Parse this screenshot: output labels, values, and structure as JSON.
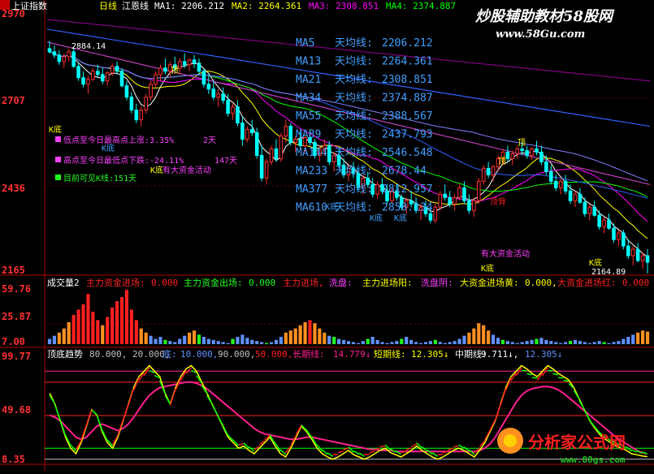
{
  "colors": {
    "bg": "#000000",
    "axis": "#b00000",
    "grid": "#700000",
    "up": "#ff3030",
    "down": "#00ffff",
    "ma": [
      "#ffffff",
      "#ffff00",
      "#ff00ff",
      "#00ff00",
      "#3060ff",
      "#8080ff",
      "#c040c0",
      "#a0a0a0",
      "#800080",
      "#d0d0d0"
    ],
    "vol_red": "#ff2020",
    "vol_orange": "#ff9020",
    "vol_blue": "#6090ff",
    "vol_green": "#20ff20",
    "osc_yellow": "#ffff00",
    "osc_green": "#00ff00",
    "osc_red": "#ff2020",
    "osc_pink": "#ff2090",
    "osc_gray": "#c0c0c0",
    "label_cyan": "#40a0ff",
    "label_yellow": "#ffff00",
    "label_magenta": "#ff40ff",
    "wm_red": "#ff2020",
    "wm_green": "#20c020",
    "wm_orange": "#ff8000",
    "wm_gold": "#ffd000"
  },
  "header": {
    "symbol": "上证指数",
    "period": "日线",
    "indicator": "江恩线",
    "ma1": "MA1: 2206.212",
    "ma2": "MA2: 2264.361",
    "ma3": "MA3: 2308.851",
    "ma4": "MA4: 2374.887"
  },
  "watermark_top": "炒股辅助教材58股网",
  "watermark_top_url": "www.58Gu.com",
  "watermark_bottom": "分析家公式网",
  "watermark_bottom_url": "www.88gs.com",
  "ma_legend": [
    {
      "name": "MA5",
      "label": "天均线:",
      "value": "2206.212"
    },
    {
      "name": "MA13",
      "label": "天均线:",
      "value": "2264.361"
    },
    {
      "name": "MA21",
      "label": "天均线:",
      "value": "2308.851"
    },
    {
      "name": "MA34",
      "label": "天均线:",
      "value": "2374.887"
    },
    {
      "name": "MA55",
      "label": "天均线:",
      "value": "2388.567"
    },
    {
      "name": "MA89",
      "label": "天均线:",
      "value": "2437.793"
    },
    {
      "name": "MA144",
      "label": "天均线:",
      "value": "2546.548"
    },
    {
      "name": "MA233",
      "label": "天均线:",
      "value": "2678.44"
    },
    {
      "name": "MA377",
      "label": "天均线:",
      "value": "2812.957"
    },
    {
      "name": "MA610",
      "label": "天均线:",
      "value": "2850.134"
    }
  ],
  "stats": [
    {
      "text": "低点至今日最高点上涨:3.35%",
      "extra": "2天",
      "color": "#ff40ff"
    },
    {
      "text": "高点至今日最低点下跌:-24.11%",
      "extra": "147天",
      "color": "#ff40ff"
    },
    {
      "text": "目前可见K线:151天",
      "extra": "",
      "color": "#20ff20"
    }
  ],
  "annotations": {
    "k_bottom": "K底",
    "top": "顶",
    "big_fund": "有大资金活动",
    "price_high": "2884.14",
    "price_low": "2164.89",
    "weak": "顶背"
  },
  "price_axis": {
    "ticks": [
      "2970",
      "2707",
      "2436",
      "2165"
    ]
  },
  "volume_panel": {
    "title": "成交量2",
    "items": [
      {
        "label": "主力资金进场:",
        "value": "0.000",
        "color": "#ff2020"
      },
      {
        "label": "主力资金出场:",
        "value": "0.000",
        "color": "#20ff20"
      },
      {
        "label": "主力进场,",
        "value": "",
        "color": "#ff2020"
      },
      {
        "label": "洗盘:",
        "value": "",
        "color": "#ff40ff"
      },
      {
        "label": "主力进场阳:",
        "value": "",
        "color": "#ffff00"
      },
      {
        "label": "洗盘阴:",
        "value": "",
        "color": "#ff40ff"
      },
      {
        "label": "大资金进场黄:",
        "value": "0.000,",
        "color": "#ffff00"
      },
      {
        "label": "大资金进场红:",
        "value": "0.000",
        "color": "#ff2020"
      }
    ],
    "ticks": [
      "59.76",
      "25.87",
      "7.00"
    ]
  },
  "osc_panel": {
    "title": "顶底趋势",
    "params": "80.000, 20.000,",
    "items": [
      {
        "label": "底:",
        "value": "10.000,",
        "color": "#6090ff"
      },
      {
        "label": "",
        "value": "90.000,",
        "color": "#c0c0c0"
      },
      {
        "label": "",
        "value": "50.000,",
        "color": "#ff2020"
      },
      {
        "label": "长期线:",
        "value": "14.779↓",
        "color": "#ff2090"
      },
      {
        "label": "短期线:",
        "value": "12.305↓",
        "color": "#ffff00"
      },
      {
        "label": "中期线:",
        "value": "9.711↓,",
        "color": "#ffffff"
      },
      {
        "label": "",
        "value": "12.305↓",
        "color": "#6090ff"
      }
    ],
    "ticks": [
      "99.77",
      "49.68",
      "8.35"
    ]
  },
  "chart_data": {
    "type": "line",
    "series_price": {
      "name": "上证指数",
      "high_label": "2884.14",
      "low_label": "2164.89",
      "ohlc": [
        [
          2860,
          2884,
          2845,
          2850
        ],
        [
          2850,
          2870,
          2830,
          2840
        ],
        [
          2840,
          2855,
          2810,
          2820
        ],
        [
          2820,
          2845,
          2800,
          2835
        ],
        [
          2835,
          2860,
          2820,
          2850
        ],
        [
          2850,
          2865,
          2800,
          2805
        ],
        [
          2805,
          2815,
          2760,
          2770
        ],
        [
          2770,
          2790,
          2740,
          2750
        ],
        [
          2750,
          2775,
          2720,
          2765
        ],
        [
          2765,
          2800,
          2760,
          2790
        ],
        [
          2790,
          2810,
          2770,
          2780
        ],
        [
          2780,
          2800,
          2750,
          2760
        ],
        [
          2760,
          2790,
          2745,
          2785
        ],
        [
          2785,
          2815,
          2775,
          2805
        ],
        [
          2805,
          2820,
          2780,
          2790
        ],
        [
          2790,
          2800,
          2740,
          2745
        ],
        [
          2745,
          2760,
          2700,
          2710
        ],
        [
          2710,
          2725,
          2660,
          2670
        ],
        [
          2670,
          2690,
          2630,
          2640
        ],
        [
          2640,
          2680,
          2620,
          2670
        ],
        [
          2670,
          2720,
          2660,
          2710
        ],
        [
          2710,
          2760,
          2700,
          2750
        ],
        [
          2750,
          2790,
          2740,
          2780
        ],
        [
          2780,
          2810,
          2760,
          2800
        ],
        [
          2800,
          2830,
          2780,
          2790
        ],
        [
          2790,
          2820,
          2770,
          2810
        ],
        [
          2810,
          2835,
          2790,
          2800
        ],
        [
          2800,
          2830,
          2780,
          2820
        ],
        [
          2820,
          2845,
          2800,
          2810
        ],
        [
          2810,
          2830,
          2790,
          2825
        ],
        [
          2825,
          2840,
          2800,
          2815
        ],
        [
          2815,
          2830,
          2780,
          2790
        ],
        [
          2790,
          2800,
          2740,
          2750
        ],
        [
          2750,
          2780,
          2720,
          2735
        ],
        [
          2735,
          2760,
          2700,
          2710
        ],
        [
          2710,
          2735,
          2680,
          2720
        ],
        [
          2720,
          2740,
          2690,
          2700
        ],
        [
          2700,
          2720,
          2650,
          2660
        ],
        [
          2660,
          2690,
          2640,
          2680
        ],
        [
          2680,
          2700,
          2620,
          2630
        ],
        [
          2630,
          2650,
          2560,
          2580
        ],
        [
          2580,
          2620,
          2570,
          2610
        ],
        [
          2610,
          2640,
          2590,
          2600
        ],
        [
          2600,
          2615,
          2520,
          2530
        ],
        [
          2530,
          2560,
          2450,
          2460
        ],
        [
          2460,
          2520,
          2440,
          2510
        ],
        [
          2510,
          2560,
          2500,
          2550
        ],
        [
          2550,
          2580,
          2510,
          2520
        ],
        [
          2520,
          2600,
          2510,
          2590
        ],
        [
          2590,
          2640,
          2570,
          2620
        ],
        [
          2620,
          2630,
          2560,
          2570
        ],
        [
          2570,
          2590,
          2540,
          2580
        ],
        [
          2580,
          2600,
          2550,
          2560
        ],
        [
          2560,
          2590,
          2540,
          2585
        ],
        [
          2585,
          2610,
          2560,
          2570
        ],
        [
          2570,
          2580,
          2520,
          2530
        ],
        [
          2530,
          2560,
          2510,
          2550
        ],
        [
          2550,
          2580,
          2530,
          2560
        ],
        [
          2560,
          2575,
          2500,
          2510
        ],
        [
          2510,
          2540,
          2480,
          2530
        ],
        [
          2530,
          2550,
          2490,
          2500
        ],
        [
          2500,
          2520,
          2460,
          2470
        ],
        [
          2470,
          2500,
          2450,
          2490
        ],
        [
          2490,
          2510,
          2460,
          2475
        ],
        [
          2475,
          2490,
          2420,
          2430
        ],
        [
          2430,
          2470,
          2410,
          2460
        ],
        [
          2460,
          2480,
          2430,
          2440
        ],
        [
          2440,
          2460,
          2400,
          2410
        ],
        [
          2410,
          2450,
          2395,
          2440
        ],
        [
          2440,
          2460,
          2410,
          2420
        ],
        [
          2420,
          2440,
          2380,
          2390
        ],
        [
          2390,
          2430,
          2380,
          2420
        ],
        [
          2420,
          2440,
          2390,
          2400
        ],
        [
          2400,
          2410,
          2360,
          2370
        ],
        [
          2370,
          2400,
          2350,
          2390
        ],
        [
          2390,
          2420,
          2370,
          2380
        ],
        [
          2380,
          2400,
          2350,
          2360
        ],
        [
          2360,
          2380,
          2330,
          2370
        ],
        [
          2370,
          2390,
          2340,
          2350
        ],
        [
          2350,
          2370,
          2320,
          2330
        ],
        [
          2330,
          2380,
          2320,
          2370
        ],
        [
          2370,
          2420,
          2360,
          2410
        ],
        [
          2410,
          2440,
          2390,
          2400
        ],
        [
          2400,
          2420,
          2370,
          2380
        ],
        [
          2380,
          2410,
          2360,
          2400
        ],
        [
          2400,
          2440,
          2390,
          2430
        ],
        [
          2430,
          2450,
          2380,
          2390
        ],
        [
          2390,
          2410,
          2350,
          2360
        ],
        [
          2360,
          2400,
          2340,
          2390
        ],
        [
          2390,
          2460,
          2380,
          2450
        ],
        [
          2450,
          2500,
          2440,
          2490
        ],
        [
          2490,
          2510,
          2460,
          2470
        ],
        [
          2470,
          2500,
          2450,
          2495
        ],
        [
          2495,
          2530,
          2480,
          2520
        ],
        [
          2520,
          2550,
          2500,
          2540
        ],
        [
          2540,
          2560,
          2510,
          2520
        ],
        [
          2520,
          2545,
          2500,
          2535
        ],
        [
          2535,
          2560,
          2520,
          2550
        ],
        [
          2550,
          2570,
          2530,
          2545
        ],
        [
          2545,
          2560,
          2520,
          2530
        ],
        [
          2530,
          2555,
          2515,
          2550
        ],
        [
          2550,
          2575,
          2530,
          2540
        ],
        [
          2540,
          2560,
          2500,
          2510
        ],
        [
          2510,
          2530,
          2470,
          2480
        ],
        [
          2480,
          2500,
          2440,
          2450
        ],
        [
          2450,
          2470,
          2420,
          2430
        ],
        [
          2430,
          2460,
          2410,
          2450
        ],
        [
          2450,
          2470,
          2410,
          2420
        ],
        [
          2420,
          2440,
          2380,
          2390
        ],
        [
          2390,
          2420,
          2370,
          2410
        ],
        [
          2410,
          2430,
          2380,
          2385
        ],
        [
          2385,
          2400,
          2340,
          2350
        ],
        [
          2350,
          2380,
          2330,
          2370
        ],
        [
          2370,
          2390,
          2340,
          2345
        ],
        [
          2345,
          2360,
          2300,
          2310
        ],
        [
          2310,
          2340,
          2290,
          2330
        ],
        [
          2330,
          2350,
          2300,
          2305
        ],
        [
          2305,
          2320,
          2260,
          2270
        ],
        [
          2270,
          2300,
          2250,
          2290
        ],
        [
          2290,
          2300,
          2240,
          2250
        ],
        [
          2250,
          2270,
          2210,
          2220
        ],
        [
          2220,
          2250,
          2190,
          2240
        ],
        [
          2240,
          2260,
          2200,
          2205
        ],
        [
          2205,
          2230,
          2180,
          2220
        ],
        [
          2220,
          2240,
          2165,
          2200
        ]
      ]
    },
    "price_range": [
      2165,
      2970
    ],
    "volume": {
      "range": [
        7.0,
        59.76
      ],
      "values": [
        12,
        15,
        18,
        22,
        28,
        35,
        40,
        45,
        55,
        38,
        30,
        25,
        33,
        42,
        48,
        52,
        59,
        40,
        30,
        22,
        18,
        15,
        12,
        14,
        11,
        10,
        9,
        12,
        15,
        18,
        20,
        16,
        14,
        12,
        11,
        10,
        9,
        8,
        12,
        14,
        16,
        13,
        11,
        10,
        9,
        8,
        9,
        11,
        14,
        18,
        20,
        22,
        25,
        28,
        30,
        27,
        22,
        18,
        15,
        14,
        12,
        11,
        10,
        9,
        8,
        10,
        12,
        14,
        11,
        9,
        8,
        9,
        10,
        12,
        14,
        11,
        9,
        8,
        9,
        10,
        11,
        9,
        8,
        9,
        10,
        12,
        15,
        18,
        22,
        27,
        25,
        20,
        16,
        13,
        11,
        10,
        9,
        8,
        9,
        10,
        11,
        12,
        13,
        11,
        10,
        9,
        8,
        9,
        10,
        11,
        10,
        9,
        8,
        9,
        10,
        9,
        8,
        9,
        10,
        12,
        14,
        16,
        18,
        20,
        19
      ]
    },
    "osc": {
      "range": [
        8.35,
        99.77
      ],
      "short": [
        70,
        60,
        45,
        30,
        20,
        15,
        25,
        40,
        55,
        50,
        35,
        25,
        20,
        30,
        45,
        60,
        75,
        85,
        90,
        95,
        90,
        85,
        70,
        60,
        75,
        85,
        92,
        95,
        90,
        80,
        70,
        60,
        50,
        40,
        30,
        25,
        20,
        22,
        18,
        15,
        20,
        25,
        30,
        22,
        15,
        12,
        20,
        30,
        40,
        35,
        28,
        20,
        15,
        12,
        10,
        12,
        15,
        18,
        14,
        12,
        10,
        12,
        15,
        18,
        20,
        16,
        14,
        12,
        15,
        18,
        22,
        18,
        15,
        12,
        10,
        12,
        15,
        18,
        20,
        18,
        15,
        12,
        18,
        25,
        35,
        45,
        60,
        75,
        85,
        90,
        95,
        92,
        88,
        85,
        90,
        95,
        92,
        88,
        85,
        82,
        75,
        65,
        55,
        45,
        38,
        32,
        28,
        25,
        22,
        20,
        18,
        15,
        14,
        13,
        12.3
      ],
      "mid": [
        50,
        48,
        45,
        40,
        35,
        30,
        28,
        30,
        35,
        40,
        42,
        40,
        38,
        36,
        38,
        42,
        48,
        55,
        62,
        68,
        72,
        75,
        76,
        77,
        78,
        79,
        80,
        80,
        79,
        77,
        74,
        70,
        66,
        62,
        58,
        54,
        50,
        46,
        42,
        38,
        35,
        33,
        32,
        31,
        30,
        29,
        28,
        28,
        29,
        30,
        30,
        29,
        28,
        27,
        26,
        25,
        24,
        23,
        22,
        21,
        20,
        19,
        19,
        18,
        18,
        18,
        17,
        17,
        17,
        17,
        17,
        17,
        17,
        17,
        17,
        17,
        17,
        17,
        17,
        17,
        17,
        17,
        18,
        20,
        24,
        30,
        38,
        46,
        54,
        62,
        68,
        72,
        74,
        75,
        76,
        76,
        75,
        73,
        70,
        66,
        62,
        58,
        54,
        50,
        46,
        42,
        38,
        34,
        30,
        27,
        24,
        21,
        18,
        16,
        14.8
      ]
    }
  }
}
